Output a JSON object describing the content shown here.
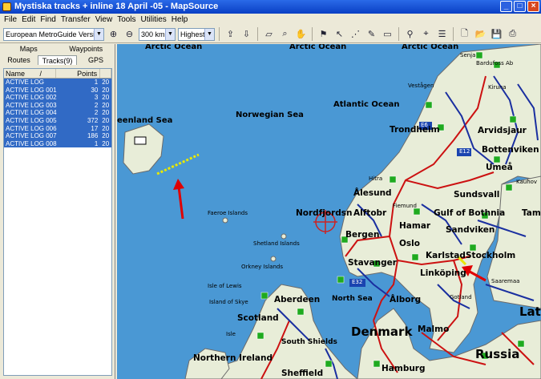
{
  "window": {
    "title": "Mystiska tracks + inline 18 April -05 - MapSource"
  },
  "menu": [
    "File",
    "Edit",
    "Find",
    "Transfer",
    "View",
    "Tools",
    "Utilities",
    "Help"
  ],
  "toolbar": {
    "product": "European MetroGuide Version 6",
    "zoom": "300 km",
    "detail": "Highest"
  },
  "left_panel": {
    "tabs_top": [
      "Maps",
      "Waypoints"
    ],
    "tabs_bottom": [
      "Routes",
      "Tracks(9)",
      "GPS"
    ],
    "active_tab": "Tracks(9)",
    "columns": [
      "Name",
      "/",
      "Points",
      ""
    ],
    "rows": [
      {
        "name": "ACTIVE LOG",
        "points": "1",
        "extra": "20"
      },
      {
        "name": "ACTIVE LOG 001",
        "points": "30",
        "extra": "20"
      },
      {
        "name": "ACTIVE LOG 002",
        "points": "3",
        "extra": "20"
      },
      {
        "name": "ACTIVE LOG 003",
        "points": "2",
        "extra": "20"
      },
      {
        "name": "ACTIVE LOG 004",
        "points": "2",
        "extra": "20"
      },
      {
        "name": "ACTIVE LOG 005",
        "points": "372",
        "extra": "20"
      },
      {
        "name": "ACTIVE LOG 006",
        "points": "17",
        "extra": "20"
      },
      {
        "name": "ACTIVE LOG 007",
        "points": "186",
        "extra": "20"
      },
      {
        "name": "ACTIVE LOG 008",
        "points": "1",
        "extra": "20"
      }
    ]
  },
  "map": {
    "colors": {
      "sea": "#4a98d4",
      "land": "#e8edd8",
      "highway": "#cc1111",
      "road": "#1a2fa0",
      "track": "#e8e800",
      "arrow": "#e00000"
    },
    "labels": {
      "arctic1": "Arctic Ocean",
      "arctic2": "Arctic Ocean",
      "arctic3": "Arctic Ocean",
      "norwegian": "Norwegian Sea",
      "atlantic": "Atlantic Ocean",
      "greenland": "eenland Sea",
      "faeroe": "Faeroe Islands",
      "shetland": "Shetland Islands",
      "orkney": "Orkney Islands",
      "lewis": "Isle of Lewis",
      "skye": "Island of Skye",
      "northsea": "North Sea",
      "southshields": "South Shields",
      "aberdeen": "Aberdeen",
      "scotland": "Scotland",
      "nireland": "Northern Ireland",
      "sheffield": "Sheffield",
      "isle": "Isle",
      "trondheim": "Trondheim",
      "alesund": "Ålesund",
      "nordfjord": "Nordfjordsn",
      "alftobr": "Alftobr",
      "bergen": "Bergen",
      "stavanger": "Stavanger",
      "hamar": "Hamar",
      "oslo": "Oslo",
      "karlstad": "Karlstad",
      "stockholm": "Stockholm",
      "linkoping": "Linköping",
      "gulfbothnia": "Gulf of Bothnia",
      "sandviken": "Sandviken",
      "sundsvall": "Sundsvall",
      "umea": "Umeå",
      "bottenviken": "Bottenviken",
      "arvidsjaur": "Arvidsjaur",
      "kiruna": "Kiruna",
      "bardufoss": "Bardufoss Ab",
      "senja": "Senja",
      "vestagen": "Vestågen",
      "aalborg": "Ålborg",
      "malmo": "Malmo",
      "denmark": "Denmark",
      "russia": "Russia",
      "hamburg": "Hamburg",
      "latvia": "Latv",
      "tampere": "Tamp",
      "kauhava": "Kauhov",
      "gotland": "Gotland",
      "saaremaa": "Saaremaa",
      "fiemund": "Fiemund",
      "hitra": "Hitra",
      "e6": "E6",
      "e12": "E12",
      "e32": "E32"
    }
  }
}
